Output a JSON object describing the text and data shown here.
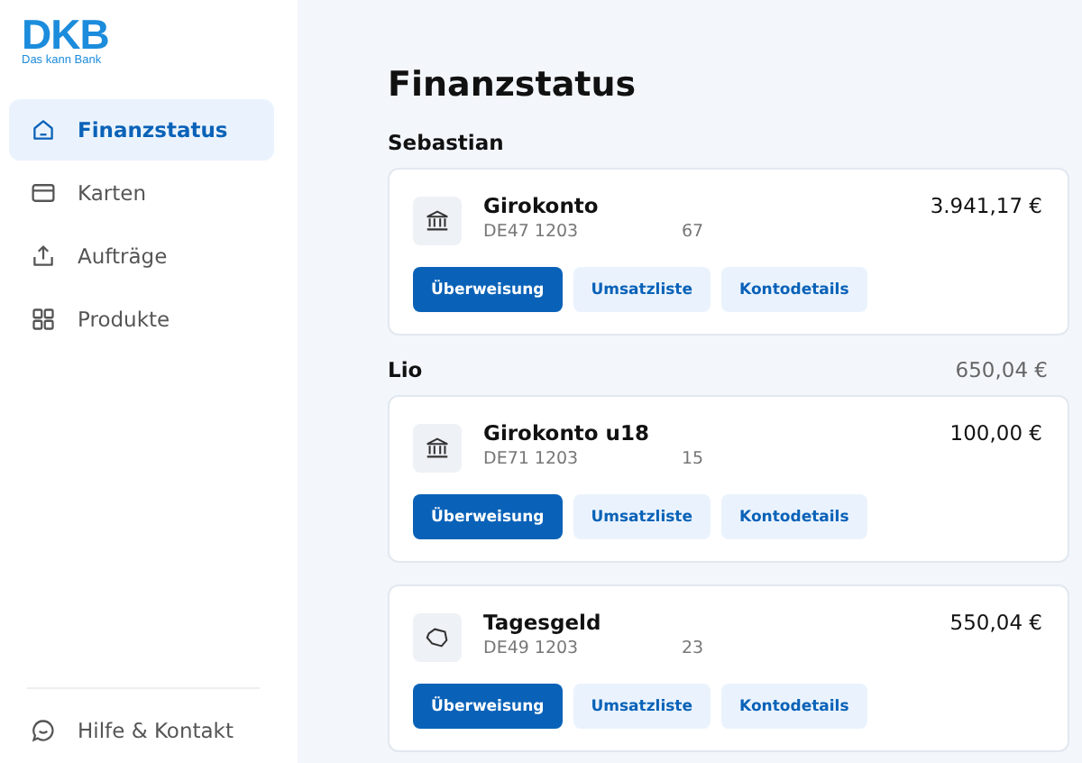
{
  "logo": {
    "brand": "DKB",
    "tagline": "Das kann Bank"
  },
  "nav": [
    {
      "label": "Finanzstatus",
      "selected": true
    },
    {
      "label": "Karten",
      "selected": false
    },
    {
      "label": "Aufträge",
      "selected": false
    },
    {
      "label": "Produkte",
      "selected": false
    }
  ],
  "help": {
    "label": "Hilfe & Kontakt"
  },
  "title": "Finanzstatus",
  "groups": [
    {
      "owner": "Sebastian",
      "accounts": [
        {
          "name": "Girokonto",
          "iban_start": "DE47 1203",
          "iban_end": "67",
          "balance": "3.941,17 €",
          "kind": "checking",
          "actions": [
            "Überweisung",
            "Umsatzliste",
            "Kontodetails"
          ]
        }
      ]
    },
    {
      "owner": "Lio",
      "total": "650,04 €",
      "accounts": [
        {
          "name": "Girokonto u18",
          "iban_start": "DE71 1203",
          "iban_end": "15",
          "balance": "100,00 €",
          "kind": "checking",
          "actions": [
            "Überweisung",
            "Umsatzliste",
            "Kontodetails"
          ]
        },
        {
          "name": "Tagesgeld",
          "iban_start": "DE49 1203",
          "iban_end": "23",
          "balance": "550,04 €",
          "kind": "savings",
          "actions": [
            "Überweisung",
            "Umsatzliste",
            "Kontodetails"
          ]
        }
      ]
    }
  ]
}
